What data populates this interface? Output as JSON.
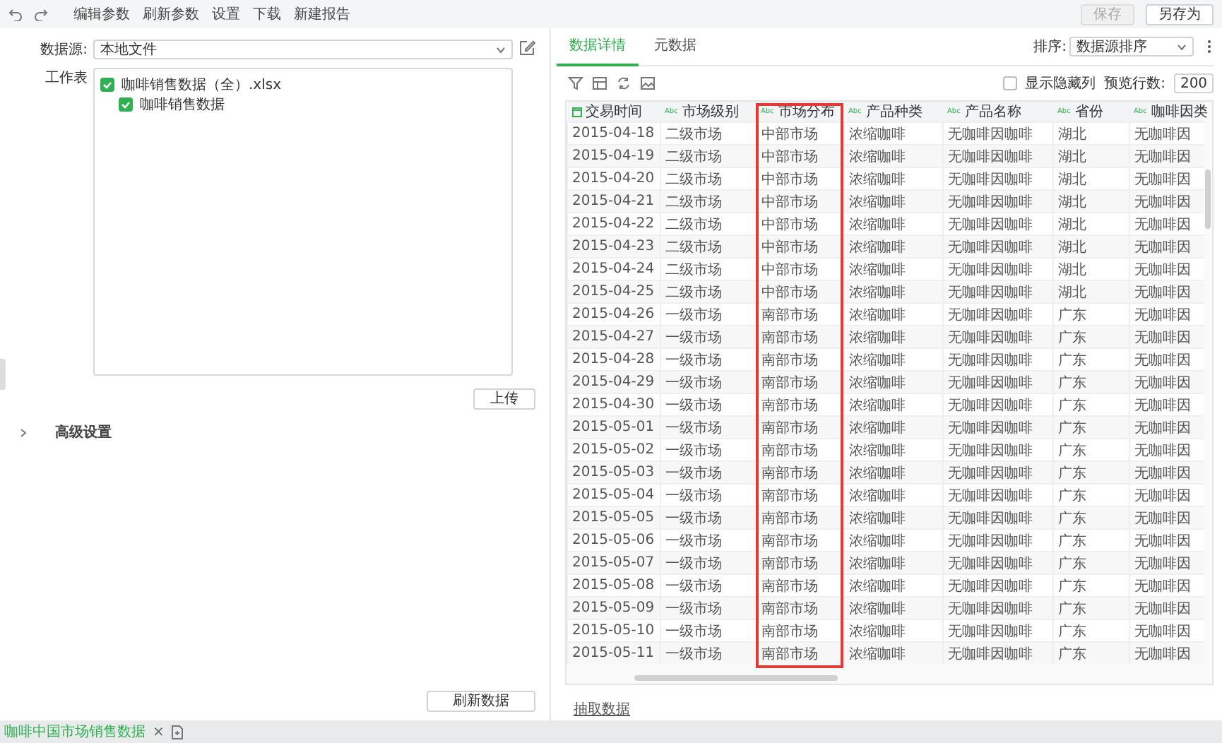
{
  "toolbar": {
    "menu": [
      {
        "label": "编辑参数"
      },
      {
        "label": "刷新参数"
      },
      {
        "label": "设置"
      },
      {
        "label": "下载"
      },
      {
        "label": "新建报告"
      }
    ],
    "save": {
      "label": "保存",
      "disabled": true
    },
    "save_as": {
      "label": "另存为",
      "disabled": false
    }
  },
  "source_panel": {
    "source_label": "数据源:",
    "source_value": "本地文件",
    "sheet_label": "工作表",
    "sheets": [
      {
        "label": "咖啡销售数据（全）.xlsx",
        "checked": true,
        "children": [
          {
            "label": "咖啡销售数据",
            "checked": true
          }
        ]
      }
    ],
    "upload": "上传",
    "advanced": {
      "label": "高级设置",
      "expanded": false
    },
    "refresh": "刷新数据"
  },
  "detail_panel": {
    "tabs": [
      {
        "label": "数据详情",
        "selected": true
      },
      {
        "label": "元数据",
        "selected": false
      }
    ],
    "sort_label": "排序:",
    "sort_value": "数据源排序",
    "show_hidden": {
      "label": "显示隐藏列",
      "checked": false
    },
    "preview_label": "预览行数:",
    "preview_value": "200",
    "table": {
      "columns": [
        {
          "label": "交易时间",
          "kind": "date",
          "highlighted": false
        },
        {
          "label": "市场级别",
          "kind": "text",
          "badge": "Abc",
          "highlighted": false
        },
        {
          "label": "市场分布",
          "kind": "text",
          "badge": "Abc",
          "highlighted": true
        },
        {
          "label": "产品种类",
          "kind": "text",
          "badge": "Abc",
          "highlighted": false
        },
        {
          "label": "产品名称",
          "kind": "text",
          "badge": "Abc",
          "highlighted": false
        },
        {
          "label": "省份",
          "kind": "text",
          "badge": "Abc",
          "highlighted": false
        },
        {
          "label": "咖啡因类",
          "kind": "text",
          "badge": "Abc",
          "highlighted": false
        }
      ],
      "rows": [
        [
          "2015-04-18",
          "二级市场",
          "中部市场",
          "浓缩咖啡",
          "无咖啡因咖啡",
          "湖北",
          "无咖啡因"
        ],
        [
          "2015-04-19",
          "二级市场",
          "中部市场",
          "浓缩咖啡",
          "无咖啡因咖啡",
          "湖北",
          "无咖啡因"
        ],
        [
          "2015-04-20",
          "二级市场",
          "中部市场",
          "浓缩咖啡",
          "无咖啡因咖啡",
          "湖北",
          "无咖啡因"
        ],
        [
          "2015-04-21",
          "二级市场",
          "中部市场",
          "浓缩咖啡",
          "无咖啡因咖啡",
          "湖北",
          "无咖啡因"
        ],
        [
          "2015-04-22",
          "二级市场",
          "中部市场",
          "浓缩咖啡",
          "无咖啡因咖啡",
          "湖北",
          "无咖啡因"
        ],
        [
          "2015-04-23",
          "二级市场",
          "中部市场",
          "浓缩咖啡",
          "无咖啡因咖啡",
          "湖北",
          "无咖啡因"
        ],
        [
          "2015-04-24",
          "二级市场",
          "中部市场",
          "浓缩咖啡",
          "无咖啡因咖啡",
          "湖北",
          "无咖啡因"
        ],
        [
          "2015-04-25",
          "二级市场",
          "中部市场",
          "浓缩咖啡",
          "无咖啡因咖啡",
          "湖北",
          "无咖啡因"
        ],
        [
          "2015-04-26",
          "一级市场",
          "南部市场",
          "浓缩咖啡",
          "无咖啡因咖啡",
          "广东",
          "无咖啡因"
        ],
        [
          "2015-04-27",
          "一级市场",
          "南部市场",
          "浓缩咖啡",
          "无咖啡因咖啡",
          "广东",
          "无咖啡因"
        ],
        [
          "2015-04-28",
          "一级市场",
          "南部市场",
          "浓缩咖啡",
          "无咖啡因咖啡",
          "广东",
          "无咖啡因"
        ],
        [
          "2015-04-29",
          "一级市场",
          "南部市场",
          "浓缩咖啡",
          "无咖啡因咖啡",
          "广东",
          "无咖啡因"
        ],
        [
          "2015-04-30",
          "一级市场",
          "南部市场",
          "浓缩咖啡",
          "无咖啡因咖啡",
          "广东",
          "无咖啡因"
        ],
        [
          "2015-05-01",
          "一级市场",
          "南部市场",
          "浓缩咖啡",
          "无咖啡因咖啡",
          "广东",
          "无咖啡因"
        ],
        [
          "2015-05-02",
          "一级市场",
          "南部市场",
          "浓缩咖啡",
          "无咖啡因咖啡",
          "广东",
          "无咖啡因"
        ],
        [
          "2015-05-03",
          "一级市场",
          "南部市场",
          "浓缩咖啡",
          "无咖啡因咖啡",
          "广东",
          "无咖啡因"
        ],
        [
          "2015-05-04",
          "一级市场",
          "南部市场",
          "浓缩咖啡",
          "无咖啡因咖啡",
          "广东",
          "无咖啡因"
        ],
        [
          "2015-05-05",
          "一级市场",
          "南部市场",
          "浓缩咖啡",
          "无咖啡因咖啡",
          "广东",
          "无咖啡因"
        ],
        [
          "2015-05-06",
          "一级市场",
          "南部市场",
          "浓缩咖啡",
          "无咖啡因咖啡",
          "广东",
          "无咖啡因"
        ],
        [
          "2015-05-07",
          "一级市场",
          "南部市场",
          "浓缩咖啡",
          "无咖啡因咖啡",
          "广东",
          "无咖啡因"
        ],
        [
          "2015-05-08",
          "一级市场",
          "南部市场",
          "浓缩咖啡",
          "无咖啡因咖啡",
          "广东",
          "无咖啡因"
        ],
        [
          "2015-05-09",
          "一级市场",
          "南部市场",
          "浓缩咖啡",
          "无咖啡因咖啡",
          "广东",
          "无咖啡因"
        ],
        [
          "2015-05-10",
          "一级市场",
          "南部市场",
          "浓缩咖啡",
          "无咖啡因咖啡",
          "广东",
          "无咖啡因"
        ],
        [
          "2015-05-11",
          "一级市场",
          "南部市场",
          "浓缩咖啡",
          "无咖啡因咖啡",
          "广东",
          "无咖啡因"
        ]
      ]
    },
    "extract": "抽取数据"
  },
  "bottom_tabs": [
    {
      "label": "咖啡中国市场销售数据",
      "selected": true,
      "close": "×"
    }
  ]
}
